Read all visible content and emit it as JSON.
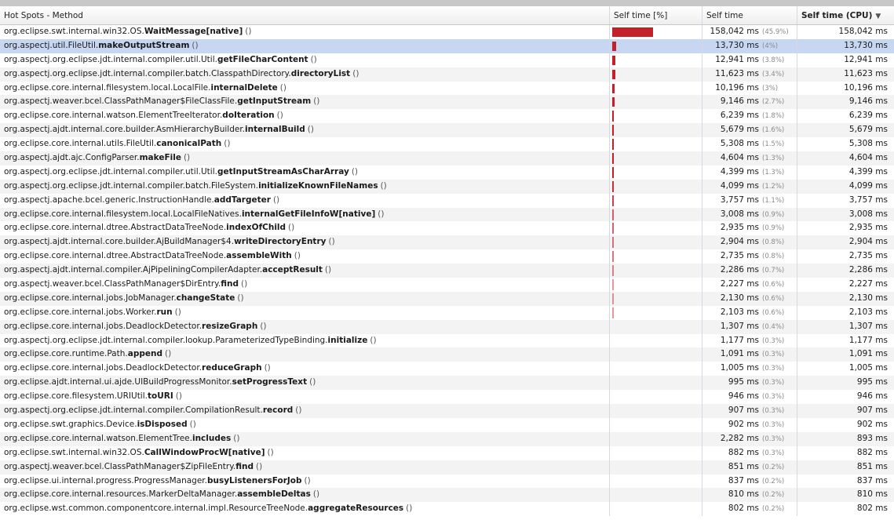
{
  "header": {
    "method": "Hot Spots - Method",
    "bar": "Self time [%]",
    "self": "Self time",
    "cpu": "Self time (CPU)",
    "sort_icon": "sort-descending-icon"
  },
  "colors": {
    "bar": "#c4202a",
    "selected": "#c7d7f1"
  },
  "rows": [
    {
      "pkg": "org.eclipse.swt.internal.win32.OS.",
      "name": "WaitMessage[native]",
      "par": "()",
      "time": "158,042 ms",
      "pct": "(45.9%)",
      "cpu": "158,042 ms",
      "frac": 0.459
    },
    {
      "pkg": "org.aspectj.util.FileUtil.",
      "name": "makeOutputStream",
      "par": "()",
      "time": "13,730 ms",
      "pct": "(4%)",
      "cpu": "13,730 ms",
      "frac": 0.04,
      "selected": true
    },
    {
      "pkg": "org.aspectj.org.eclipse.jdt.internal.compiler.util.Util.",
      "name": "getFileCharContent",
      "par": "()",
      "time": "12,941 ms",
      "pct": "(3.8%)",
      "cpu": "12,941 ms",
      "frac": 0.038
    },
    {
      "pkg": "org.aspectj.org.eclipse.jdt.internal.compiler.batch.ClasspathDirectory.",
      "name": "directoryList",
      "par": "()",
      "time": "11,623 ms",
      "pct": "(3.4%)",
      "cpu": "11,623 ms",
      "frac": 0.034
    },
    {
      "pkg": "org.eclipse.core.internal.filesystem.local.LocalFile.",
      "name": "internalDelete",
      "par": "()",
      "time": "10,196 ms",
      "pct": "(3%)",
      "cpu": "10,196 ms",
      "frac": 0.03
    },
    {
      "pkg": "org.aspectj.weaver.bcel.ClassPathManager$FileClassFile.",
      "name": "getInputStream",
      "par": "()",
      "time": "9,146 ms",
      "pct": "(2.7%)",
      "cpu": "9,146 ms",
      "frac": 0.027
    },
    {
      "pkg": "org.eclipse.core.internal.watson.ElementTreeIterator.",
      "name": "doIteration",
      "par": "()",
      "time": "6,239 ms",
      "pct": "(1.8%)",
      "cpu": "6,239 ms",
      "frac": 0.018
    },
    {
      "pkg": "org.aspectj.ajdt.internal.core.builder.AsmHierarchyBuilder.",
      "name": "internalBuild",
      "par": "()",
      "time": "5,679 ms",
      "pct": "(1.6%)",
      "cpu": "5,679 ms",
      "frac": 0.016
    },
    {
      "pkg": "org.eclipse.core.internal.utils.FileUtil.",
      "name": "canonicalPath",
      "par": "()",
      "time": "5,308 ms",
      "pct": "(1.5%)",
      "cpu": "5,308 ms",
      "frac": 0.015
    },
    {
      "pkg": "org.aspectj.ajdt.ajc.ConfigParser.",
      "name": "makeFile",
      "par": "()",
      "time": "4,604 ms",
      "pct": "(1.3%)",
      "cpu": "4,604 ms",
      "frac": 0.013
    },
    {
      "pkg": "org.aspectj.org.eclipse.jdt.internal.compiler.util.Util.",
      "name": "getInputStreamAsCharArray",
      "par": "()",
      "time": "4,399 ms",
      "pct": "(1.3%)",
      "cpu": "4,399 ms",
      "frac": 0.013
    },
    {
      "pkg": "org.aspectj.org.eclipse.jdt.internal.compiler.batch.FileSystem.",
      "name": "initializeKnownFileNames",
      "par": "()",
      "time": "4,099 ms",
      "pct": "(1.2%)",
      "cpu": "4,099 ms",
      "frac": 0.012
    },
    {
      "pkg": "org.aspectj.apache.bcel.generic.InstructionHandle.",
      "name": "addTargeter",
      "par": "()",
      "time": "3,757 ms",
      "pct": "(1.1%)",
      "cpu": "3,757 ms",
      "frac": 0.011
    },
    {
      "pkg": "org.eclipse.core.internal.filesystem.local.LocalFileNatives.",
      "name": "internalGetFileInfoW[native]",
      "par": "()",
      "time": "3,008 ms",
      "pct": "(0.9%)",
      "cpu": "3,008 ms",
      "frac": 0.009
    },
    {
      "pkg": "org.eclipse.core.internal.dtree.AbstractDataTreeNode.",
      "name": "indexOfChild",
      "par": "()",
      "time": "2,935 ms",
      "pct": "(0.9%)",
      "cpu": "2,935 ms",
      "frac": 0.009
    },
    {
      "pkg": "org.aspectj.ajdt.internal.core.builder.AjBuildManager$4.",
      "name": "writeDirectoryEntry",
      "par": "()",
      "time": "2,904 ms",
      "pct": "(0.8%)",
      "cpu": "2,904 ms",
      "frac": 0.008
    },
    {
      "pkg": "org.eclipse.core.internal.dtree.AbstractDataTreeNode.",
      "name": "assembleWith",
      "par": "()",
      "time": "2,735 ms",
      "pct": "(0.8%)",
      "cpu": "2,735 ms",
      "frac": 0.008
    },
    {
      "pkg": "org.aspectj.ajdt.internal.compiler.AjPipeliningCompilerAdapter.",
      "name": "acceptResult",
      "par": "()",
      "time": "2,286 ms",
      "pct": "(0.7%)",
      "cpu": "2,286 ms",
      "frac": 0.007
    },
    {
      "pkg": "org.aspectj.weaver.bcel.ClassPathManager$DirEntry.",
      "name": "find",
      "par": "()",
      "time": "2,227 ms",
      "pct": "(0.6%)",
      "cpu": "2,227 ms",
      "frac": 0.006
    },
    {
      "pkg": "org.eclipse.core.internal.jobs.JobManager.",
      "name": "changeState",
      "par": "()",
      "time": "2,130 ms",
      "pct": "(0.6%)",
      "cpu": "2,130 ms",
      "frac": 0.006
    },
    {
      "pkg": "org.eclipse.core.internal.jobs.Worker.",
      "name": "run",
      "par": "()",
      "time": "2,103 ms",
      "pct": "(0.6%)",
      "cpu": "2,103 ms",
      "frac": 0.006
    },
    {
      "pkg": "org.eclipse.core.internal.jobs.DeadlockDetector.",
      "name": "resizeGraph",
      "par": "()",
      "time": "1,307 ms",
      "pct": "(0.4%)",
      "cpu": "1,307 ms",
      "frac": 0.004
    },
    {
      "pkg": "org.aspectj.org.eclipse.jdt.internal.compiler.lookup.ParameterizedTypeBinding.",
      "name": "initialize",
      "par": "()",
      "time": "1,177 ms",
      "pct": "(0.3%)",
      "cpu": "1,177 ms",
      "frac": 0.003
    },
    {
      "pkg": "org.eclipse.core.runtime.Path.",
      "name": "append",
      "par": "()",
      "time": "1,091 ms",
      "pct": "(0.3%)",
      "cpu": "1,091 ms",
      "frac": 0.003
    },
    {
      "pkg": "org.eclipse.core.internal.jobs.DeadlockDetector.",
      "name": "reduceGraph",
      "par": "()",
      "time": "1,005 ms",
      "pct": "(0.3%)",
      "cpu": "1,005 ms",
      "frac": 0.003
    },
    {
      "pkg": "org.eclipse.ajdt.internal.ui.ajde.UIBuildProgressMonitor.",
      "name": "setProgressText",
      "par": "()",
      "time": "995 ms",
      "pct": "(0.3%)",
      "cpu": "995 ms",
      "frac": 0.003
    },
    {
      "pkg": "org.eclipse.core.filesystem.URIUtil.",
      "name": "toURI",
      "par": "()",
      "time": "946 ms",
      "pct": "(0.3%)",
      "cpu": "946 ms",
      "frac": 0.003
    },
    {
      "pkg": "org.aspectj.org.eclipse.jdt.internal.compiler.CompilationResult.",
      "name": "record",
      "par": "()",
      "time": "907 ms",
      "pct": "(0.3%)",
      "cpu": "907 ms",
      "frac": 0.003
    },
    {
      "pkg": "org.eclipse.swt.graphics.Device.",
      "name": "isDisposed",
      "par": "()",
      "time": "902 ms",
      "pct": "(0.3%)",
      "cpu": "902 ms",
      "frac": 0.003
    },
    {
      "pkg": "org.eclipse.core.internal.watson.ElementTree.",
      "name": "includes",
      "par": "()",
      "time": "2,282 ms",
      "pct": "(0.3%)",
      "cpu": "893 ms",
      "frac": 0.003
    },
    {
      "pkg": "org.eclipse.swt.internal.win32.OS.",
      "name": "CallWindowProcW[native]",
      "par": "()",
      "time": "882 ms",
      "pct": "(0.3%)",
      "cpu": "882 ms",
      "frac": 0.003
    },
    {
      "pkg": "org.aspectj.weaver.bcel.ClassPathManager$ZipFileEntry.",
      "name": "find",
      "par": "()",
      "time": "851 ms",
      "pct": "(0.2%)",
      "cpu": "851 ms",
      "frac": 0.002
    },
    {
      "pkg": "org.eclipse.ui.internal.progress.ProgressManager.",
      "name": "busyListenersForJob",
      "par": "()",
      "time": "837 ms",
      "pct": "(0.2%)",
      "cpu": "837 ms",
      "frac": 0.002
    },
    {
      "pkg": "org.eclipse.core.internal.resources.MarkerDeltaManager.",
      "name": "assembleDeltas",
      "par": "()",
      "time": "810 ms",
      "pct": "(0.2%)",
      "cpu": "810 ms",
      "frac": 0.002
    },
    {
      "pkg": "org.eclipse.wst.common.componentcore.internal.impl.ResourceTreeNode.",
      "name": "aggregateResources",
      "par": "()",
      "time": "802 ms",
      "pct": "(0.2%)",
      "cpu": "802 ms",
      "frac": 0.002
    }
  ]
}
